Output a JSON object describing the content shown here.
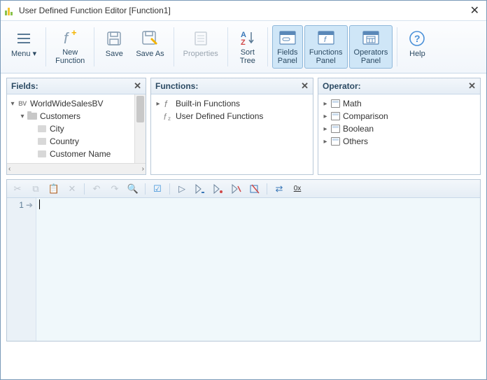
{
  "window": {
    "title": "User Defined Function Editor [Function1]"
  },
  "ribbon": {
    "menu": "Menu",
    "new_function": "New\nFunction",
    "save": "Save",
    "save_as": "Save As",
    "properties": "Properties",
    "sort_tree": "Sort\nTree",
    "fields_panel": "Fields\nPanel",
    "functions_panel": "Functions\nPanel",
    "operators_panel": "Operators\nPanel",
    "help": "Help"
  },
  "panels": {
    "fields": {
      "title": "Fields:",
      "root": "WorldWideSalesBV",
      "group": "Customers",
      "items": [
        "City",
        "Country",
        "Customer Name"
      ]
    },
    "functions": {
      "title": "Functions:",
      "items": [
        "Built-in Functions",
        "User Defined Functions"
      ]
    },
    "operators": {
      "title": "Operator:",
      "items": [
        "Math",
        "Comparison",
        "Boolean",
        "Others"
      ]
    }
  },
  "editor": {
    "line_no": "1",
    "hex_label": "0x"
  },
  "colors": {
    "accent": "#cfe6f7"
  }
}
